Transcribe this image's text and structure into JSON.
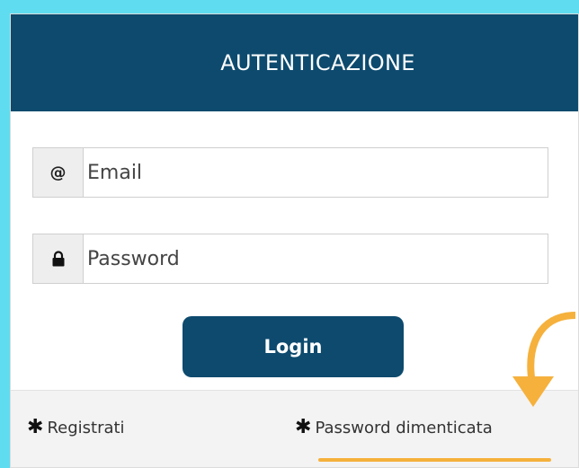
{
  "header": {
    "title": "AUTENTICAZIONE"
  },
  "email": {
    "addon": "@",
    "placeholder": "Email",
    "value": ""
  },
  "password": {
    "placeholder": "Password",
    "value": ""
  },
  "login": {
    "label": "Login"
  },
  "footer": {
    "register_label": "Registrati",
    "forgot_label": "Password dimenticata"
  },
  "icons": {
    "email": "at-icon",
    "password": "lock-icon",
    "register": "gear-icon",
    "forgot": "gear-icon",
    "annotation": "curved-arrow-icon"
  },
  "colors": {
    "background": "#5fdcf0",
    "brand": "#0d4a6e",
    "annotation": "#f5b13c"
  }
}
